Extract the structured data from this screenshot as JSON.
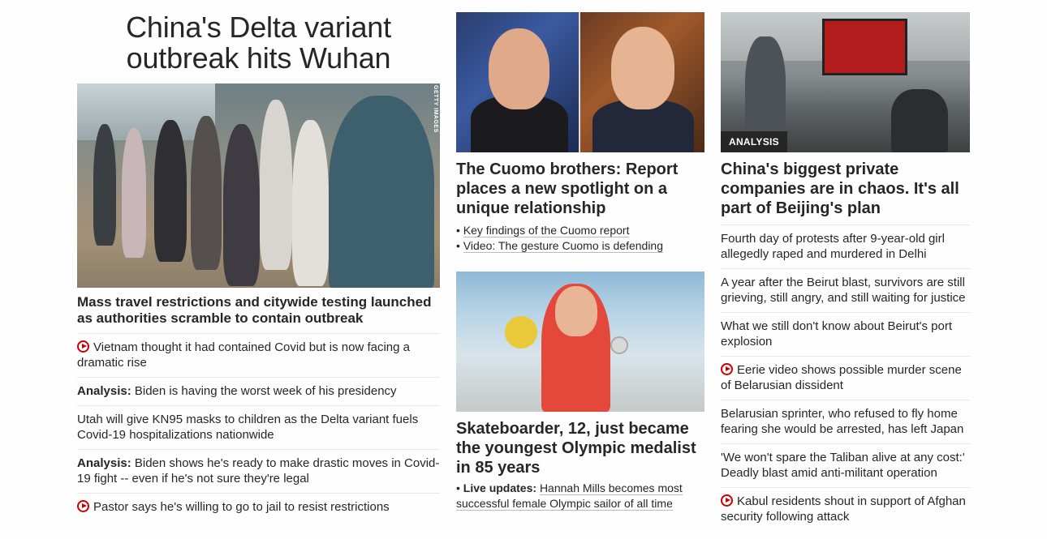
{
  "lead": {
    "title": "China's Delta variant outbreak hits Wuhan",
    "image_credit": "GETTY IMAGES",
    "headline": "Mass travel restrictions and citywide testing launched as authorities scramble to contain outbreak",
    "stories": [
      {
        "video": true,
        "prefix": "",
        "text": "Vietnam thought it had contained Covid but is now facing a dramatic rise"
      },
      {
        "video": false,
        "prefix": "Analysis:",
        "text": " Biden is having the worst week of his presidency"
      },
      {
        "video": false,
        "prefix": "",
        "text": "Utah will give KN95 masks to children as the Delta variant fuels Covid-19 hospitalizations nationwide"
      },
      {
        "video": false,
        "prefix": "Analysis:",
        "text": " Biden shows he's ready to make drastic moves in Covid-19 fight -- even if he's not sure they're legal"
      },
      {
        "video": true,
        "prefix": "",
        "text": "Pastor says he's willing to go to jail to resist restrictions"
      }
    ]
  },
  "cuomo": {
    "headline": "The Cuomo brothers: Report places a new spotlight on a unique relationship",
    "links": [
      "Key findings of the Cuomo report",
      "Video: The gesture Cuomo is defending"
    ]
  },
  "skate": {
    "headline": "Skateboarder, 12, just became the youngest Olympic medalist in 85 years",
    "link_prefix": "Live updates:",
    "link_text": "Hannah Mills becomes most successful female Olympic sailor of all time"
  },
  "china_card": {
    "badge": "ANALYSIS",
    "headline": "China's biggest private companies are in chaos. It's all part of Beijing's plan",
    "stories": [
      {
        "video": false,
        "text": "Fourth day of protests after 9-year-old girl allegedly raped and murdered in Delhi"
      },
      {
        "video": false,
        "text": "A year after the Beirut blast, survivors are still grieving, still angry, and still waiting for justice"
      },
      {
        "video": false,
        "text": "What we still don't know about Beirut's port explosion"
      },
      {
        "video": true,
        "text": "Eerie video shows possible murder scene of Belarusian dissident"
      },
      {
        "video": false,
        "text": "Belarusian sprinter, who refused to fly home fearing she would be arrested, has left Japan"
      },
      {
        "video": false,
        "text": "'We won't spare the Taliban alive at any cost:' Deadly blast amid anti-militant operation"
      },
      {
        "video": true,
        "text": "Kabul residents shout in support of Afghan security following attack"
      }
    ]
  },
  "colors": {
    "text": "#262626",
    "video_red": "#cc0000",
    "divider": "#e6e6e6"
  },
  "icons": {
    "video": "play-circle-icon"
  }
}
